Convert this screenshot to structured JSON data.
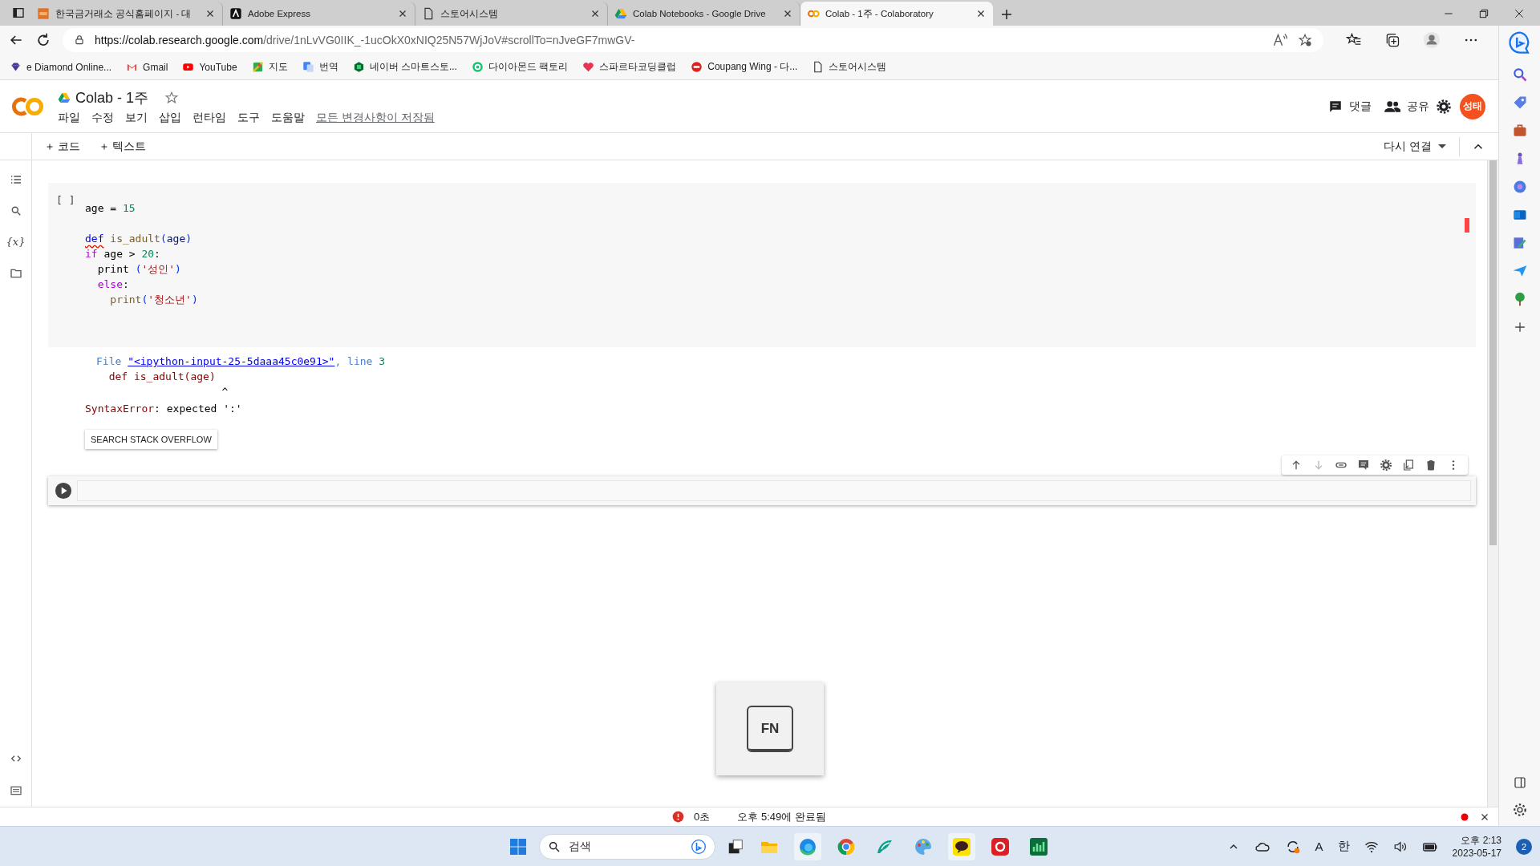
{
  "browser": {
    "tabs": [
      {
        "title": "한국금거래소 공식홈페이지 - 대",
        "selected": false
      },
      {
        "title": "Adobe Express",
        "selected": false
      },
      {
        "title": "스토어시스템",
        "selected": false
      },
      {
        "title": "Colab Notebooks - Google Drive",
        "selected": false
      },
      {
        "title": "Colab - 1주 - Colaboratory",
        "selected": true
      }
    ],
    "address": {
      "host": "https://colab.research.google.com",
      "path": "/drive/1nLvVG0IIK_-1ucOkX0xNIQ25N57WjJoV#scrollTo=nJveGF7mwGV-"
    },
    "bookmarks": [
      {
        "label": "e Diamond Online..."
      },
      {
        "label": "Gmail"
      },
      {
        "label": "YouTube"
      },
      {
        "label": "지도"
      },
      {
        "label": "번역"
      },
      {
        "label": "네이버 스마트스토..."
      },
      {
        "label": "다이아몬드 팩토리"
      },
      {
        "label": "스파르타코딩클럽"
      },
      {
        "label": "Coupang Wing - 다..."
      },
      {
        "label": "스토어시스템"
      }
    ]
  },
  "notebook": {
    "title": "Colab - 1주",
    "menu": [
      "파일",
      "수정",
      "보기",
      "삽입",
      "런타임",
      "도구",
      "도움말"
    ],
    "save_status": "모든 변경사항이 저장됨",
    "comments": "댓글",
    "share": "공유",
    "avatar": "성태",
    "add_code": "코드",
    "add_text": "텍스트",
    "connect": "다시 연결",
    "variables": "{x}",
    "cells": [
      {
        "kind": "code",
        "selected": false,
        "exec": "[ ]",
        "lines": [
          {
            "blank_after": true,
            "tokens": [
              {
                "text": "age = ",
                "kind": "plain"
              },
              {
                "text": "15",
                "kind": "number"
              }
            ]
          },
          {
            "tokens": [
              {
                "text": "def",
                "kind": "keyword",
                "squiggle": true
              },
              {
                "text": " is_adult",
                "kind": "function"
              },
              {
                "text": "(",
                "kind": "paren"
              },
              {
                "text": "age",
                "kind": "variable"
              },
              {
                "text": ")",
                "kind": "paren"
              }
            ]
          },
          {
            "tokens": [
              {
                "text": "if",
                "kind": "control"
              },
              {
                "text": " age > ",
                "kind": "plain"
              },
              {
                "text": "20",
                "kind": "number"
              },
              {
                "text": ":",
                "kind": "plain"
              }
            ]
          },
          {
            "tokens": [
              {
                "text": "  print ",
                "kind": "plain"
              },
              {
                "text": "(",
                "kind": "paren"
              },
              {
                "text": "'성인'",
                "kind": "string"
              },
              {
                "text": ")",
                "kind": "paren"
              }
            ]
          },
          {
            "tokens": [
              {
                "text": "  else",
                "kind": "control"
              },
              {
                "text": ":",
                "kind": "plain"
              }
            ]
          },
          {
            "tokens": [
              {
                "text": "    print",
                "kind": "function"
              },
              {
                "text": "(",
                "kind": "paren"
              },
              {
                "text": "'청소년'",
                "kind": "string"
              },
              {
                "text": ")",
                "kind": "paren"
              }
            ]
          }
        ],
        "output": {
          "traceback": [
            [
              {
                "text": "File ",
                "kind": "label"
              },
              {
                "text": "\"<ipython-input-25-5daaa45c0e91>\"",
                "kind": "link"
              },
              {
                "text": ", line ",
                "kind": "label"
              },
              {
                "text": "3",
                "kind": "number"
              }
            ],
            [
              {
                "text": "  def is_adult(age)",
                "kind": "error"
              }
            ],
            [
              {
                "text": "                    ^",
                "kind": "plain"
              }
            ]
          ],
          "error": [
            {
              "text": "SyntaxError",
              "kind": "error"
            },
            {
              "text": ": expected ':'",
              "kind": "plain"
            }
          ],
          "button": "SEARCH STACK OVERFLOW"
        }
      },
      {
        "kind": "code",
        "selected": true
      }
    ]
  },
  "overlay": {
    "key": "FN"
  },
  "status": {
    "elapsed": "0초",
    "completed": "오후 5:49에 완료됨"
  },
  "taskbar": {
    "search": "검색",
    "tray": [
      "A",
      "한"
    ],
    "time": "오후 2:13",
    "date": "2023-05-17",
    "notifications": "2"
  }
}
